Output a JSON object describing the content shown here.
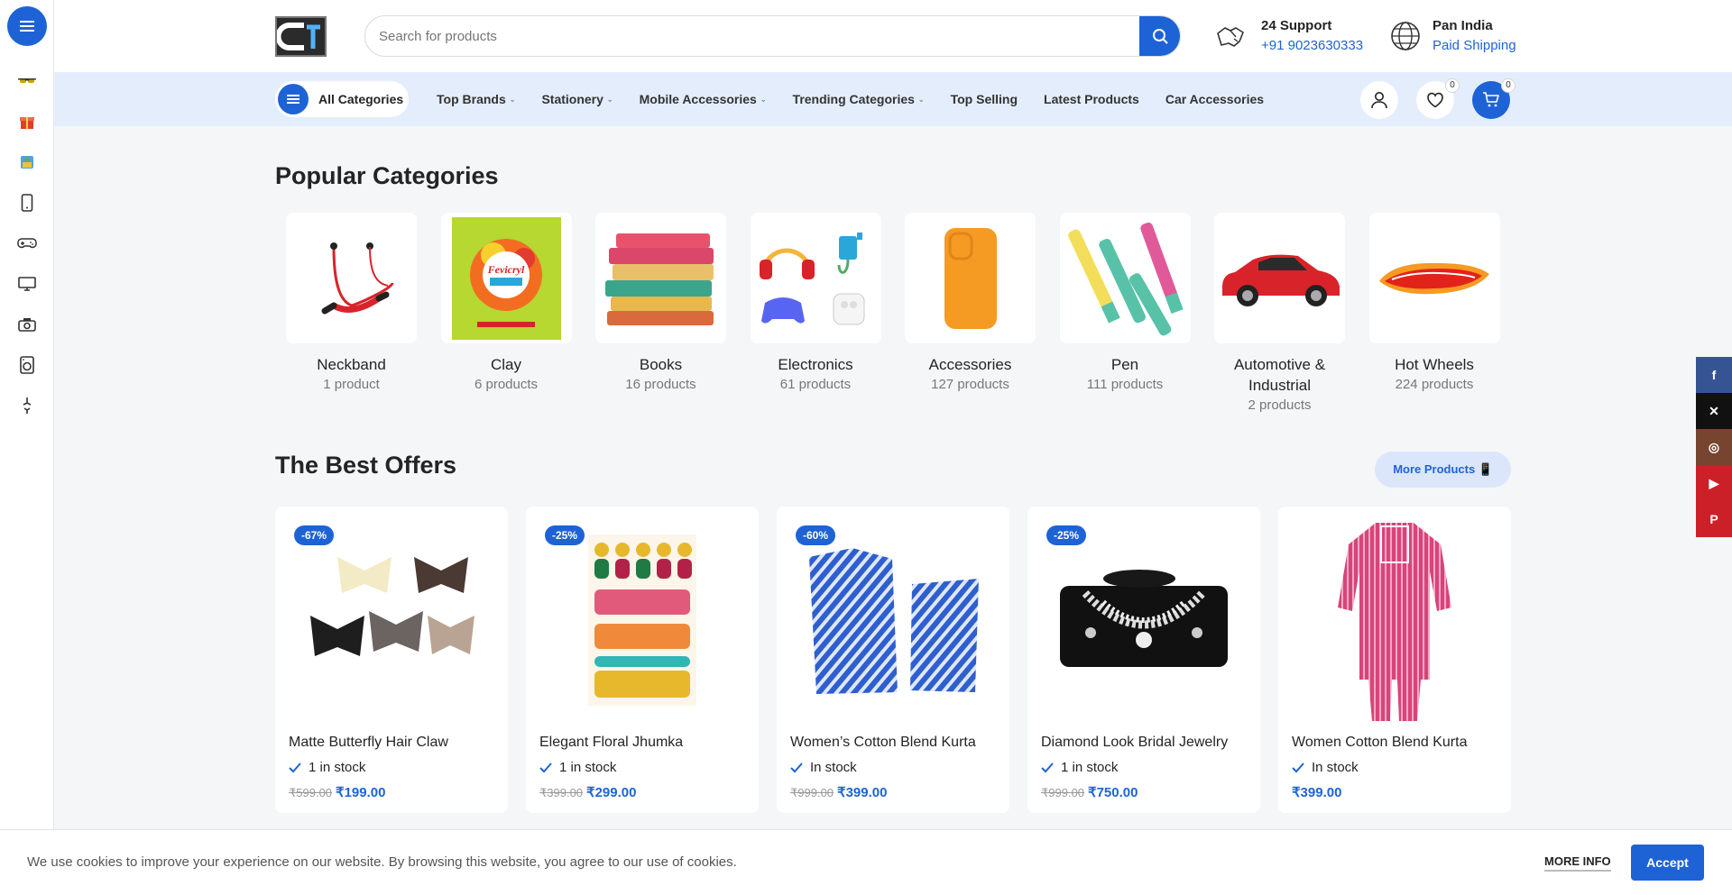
{
  "sidebar": {
    "icons": [
      "sunglasses-icon",
      "gift-box-icon",
      "kids-toy-icon",
      "mobile-phone-icon",
      "gamepad-icon",
      "monitor-icon",
      "camera-icon",
      "washing-machine-icon",
      "hanger-icon"
    ]
  },
  "header": {
    "search_placeholder": "Search for products",
    "support_title": "24 Support",
    "support_phone": "+91 9023630333",
    "shipping_title": "Pan India",
    "shipping_sub": "Paid Shipping"
  },
  "nav": {
    "all_categories": "All Categories",
    "links": [
      {
        "label": "Top Brands",
        "dropdown": true
      },
      {
        "label": "Stationery",
        "dropdown": true
      },
      {
        "label": "Mobile Accessories",
        "dropdown": true
      },
      {
        "label": "Trending Categories",
        "dropdown": true
      },
      {
        "label": "Top Selling",
        "dropdown": false
      },
      {
        "label": "Latest Products",
        "dropdown": false
      },
      {
        "label": "Car Accessories",
        "dropdown": false
      }
    ],
    "wishlist_count": "0",
    "cart_count": "0"
  },
  "popular": {
    "title": "Popular Categories",
    "categories": [
      {
        "name": "Neckband",
        "count": "1 product"
      },
      {
        "name": "Clay",
        "count": "6 products"
      },
      {
        "name": "Books",
        "count": "16 products"
      },
      {
        "name": "Electronics",
        "count": "61 products"
      },
      {
        "name": "Accessories",
        "count": "127 products"
      },
      {
        "name": "Pen",
        "count": "111 products"
      },
      {
        "name": "Automotive & Industrial",
        "count": "2 products"
      },
      {
        "name": "Hot Wheels",
        "count": "224 products"
      }
    ]
  },
  "offers": {
    "title": "The Best Offers",
    "more_button": "More Products 📱",
    "products": [
      {
        "discount": "-67%",
        "name": "Matte Butterfly Hair Claw",
        "stock": "1 in stock",
        "old_price": "₹599.00",
        "price": "₹199.00"
      },
      {
        "discount": "-25%",
        "name": "Elegant Floral Jhumka",
        "stock": "1 in stock",
        "old_price": "₹399.00",
        "price": "₹299.00"
      },
      {
        "discount": "-60%",
        "name": "Women’s Cotton Blend Kurta",
        "stock": "In stock",
        "old_price": "₹999.00",
        "price": "₹399.00"
      },
      {
        "discount": "-25%",
        "name": "Diamond Look Bridal Jewelry",
        "stock": "1 in stock",
        "old_price": "₹999.00",
        "price": "₹750.00"
      },
      {
        "discount": "",
        "name": "Women Cotton Blend Kurta",
        "stock": "In stock",
        "old_price": "",
        "price": "₹399.00"
      }
    ]
  },
  "social": [
    {
      "name": "facebook",
      "glyph": "f",
      "color": "#365493"
    },
    {
      "name": "x",
      "glyph": "✕",
      "color": "#111111"
    },
    {
      "name": "instagram",
      "glyph": "◎",
      "color": "#774430"
    },
    {
      "name": "youtube",
      "glyph": "▶",
      "color": "#cb2027"
    },
    {
      "name": "pinterest",
      "glyph": "P",
      "color": "#cb2027"
    }
  ],
  "cookie": {
    "text": "We use cookies to improve your experience on our website. By browsing this website, you agree to our use of cookies.",
    "more_info": "MORE INFO",
    "accept": "Accept"
  },
  "colors": {
    "accent": "#1e63d6",
    "nav_bg": "#e4edfb"
  }
}
